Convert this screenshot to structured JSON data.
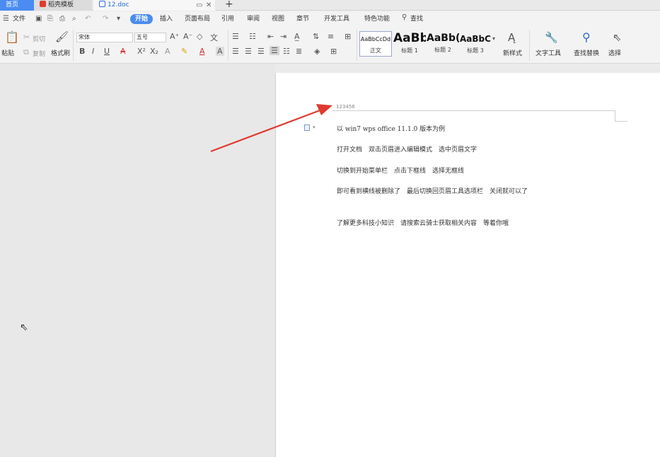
{
  "tabs": {
    "home": "首页",
    "template": "稻壳模板",
    "document": "12.doc"
  },
  "menu": {
    "file": "文件",
    "items": [
      "开始",
      "插入",
      "页面布局",
      "引用",
      "审阅",
      "视图",
      "章节",
      "开发工具",
      "特色功能"
    ],
    "search": "查找"
  },
  "ribbon": {
    "paste": "粘贴",
    "cut": "剪切",
    "copy": "复制",
    "format_painter": "格式刷",
    "font_name": "宋体",
    "font_size": "五号",
    "styles": [
      {
        "sample": "AaBbCcDd",
        "name": "正文"
      },
      {
        "sample": "AaBb",
        "name": "标题 1"
      },
      {
        "sample": "AaBb(",
        "name": "标题 2"
      },
      {
        "sample": "AaBbC(",
        "name": "标题 3"
      }
    ],
    "new_style": "新样式",
    "text_tools": "文字工具",
    "find_replace": "查找替换",
    "select": "选择"
  },
  "document": {
    "header_text": "123456",
    "paragraphs": [
      "以 win7 wps office 11.1.0 版本为例",
      "打开文档　双击页眉进入编辑模式　选中页眉文字",
      "切换到开始菜单栏　点击下框线　选择无框线",
      "即可看到横线被删除了　最后切换回页眉工具选项栏　关闭就可以了",
      "了解更多科技小知识　请搜索云骑士获取相关内容　等着你哦"
    ]
  },
  "colors": {
    "accent": "#4a8cf0",
    "arrow": "#e03a2f"
  }
}
